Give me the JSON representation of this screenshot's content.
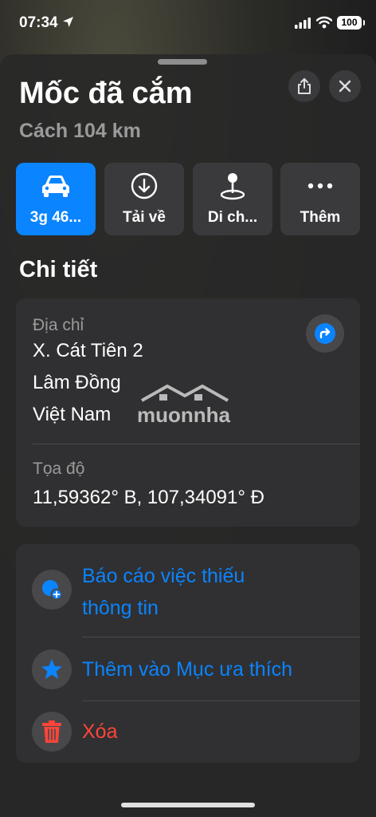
{
  "status_bar": {
    "time": "07:34",
    "battery": "100"
  },
  "place": {
    "title": "Mốc đã cắm",
    "distance": "Cách 104 km"
  },
  "actions": [
    {
      "label": "3g 46...",
      "icon": "car-icon"
    },
    {
      "label": "Tải về",
      "icon": "download-icon"
    },
    {
      "label": "Di ch...",
      "icon": "pin-icon"
    },
    {
      "label": "Thêm",
      "icon": "more-icon"
    }
  ],
  "details": {
    "section_title": "Chi tiết",
    "address_label": "Địa chỉ",
    "address_lines": [
      "X. Cát Tiên 2",
      "Lâm Đồng",
      "Việt Nam"
    ],
    "coords_label": "Tọa độ",
    "coords_value": "11,59362° B, 107,34091° Đ"
  },
  "watermark": "muonnha",
  "menu": {
    "report_line1": "Báo cáo việc thiếu",
    "report_line2": "thông tin",
    "favorite": "Thêm vào Mục ưa thích",
    "delete": "Xóa"
  },
  "colors": {
    "accent": "#0a84ff",
    "destructive": "#ff453a",
    "card": "#303032"
  }
}
